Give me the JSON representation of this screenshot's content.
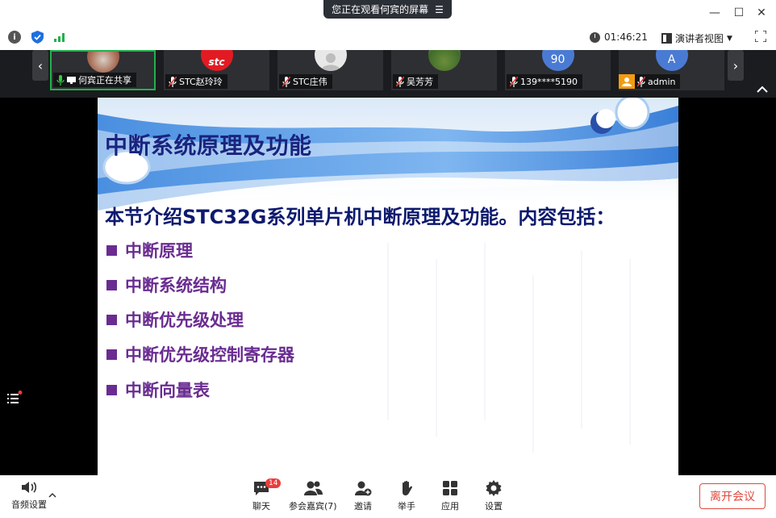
{
  "titlebar": {
    "share_notice": "您正在观看何宾的屏幕",
    "menu_icon": "hamburger-icon"
  },
  "toolbar": {
    "timer": "01:46:21",
    "view_mode": "演讲者视图"
  },
  "participants": [
    {
      "name": "何宾正在共享",
      "avatar": "photo",
      "active": true
    },
    {
      "name": "STC赵玲玲",
      "avatar": "stc-logo"
    },
    {
      "name": "STC庄伟",
      "avatar": "default"
    },
    {
      "name": "吴芳芳",
      "avatar": "photo"
    },
    {
      "name": "139****5190",
      "avatar": "90"
    },
    {
      "name": "admin",
      "avatar": "A"
    }
  ],
  "slide": {
    "title": "中断系统原理及功能",
    "intro": "本节介绍STC32G系列单片机中断原理及功能。内容包括：",
    "bullets": [
      "中断原理",
      "中断系统结构",
      "中断优先级处理",
      "中断优先级控制寄存器",
      "中断向量表"
    ]
  },
  "bottombar": {
    "audio": "音频设置",
    "chat": "聊天",
    "chat_badge": "14",
    "participants": "参会嘉宾(7)",
    "invite": "邀请",
    "raise_hand": "举手",
    "apps": "应用",
    "settings": "设置",
    "leave": "离开会议"
  },
  "colors": {
    "accent_green": "#22b14c",
    "leave_red": "#e0493e",
    "title_blue": "#1a237e",
    "bullet_purple": "#6a2c91"
  }
}
